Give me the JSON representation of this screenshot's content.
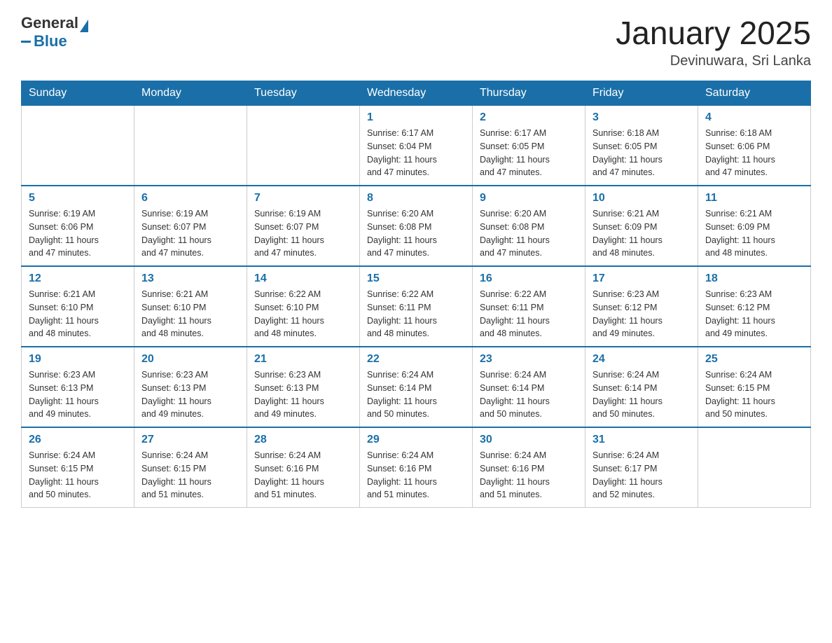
{
  "header": {
    "logo_general": "General",
    "logo_blue": "Blue",
    "title": "January 2025",
    "location": "Devinuwara, Sri Lanka"
  },
  "weekdays": [
    "Sunday",
    "Monday",
    "Tuesday",
    "Wednesday",
    "Thursday",
    "Friday",
    "Saturday"
  ],
  "weeks": [
    [
      {
        "day": "",
        "info": ""
      },
      {
        "day": "",
        "info": ""
      },
      {
        "day": "",
        "info": ""
      },
      {
        "day": "1",
        "info": "Sunrise: 6:17 AM\nSunset: 6:04 PM\nDaylight: 11 hours\nand 47 minutes."
      },
      {
        "day": "2",
        "info": "Sunrise: 6:17 AM\nSunset: 6:05 PM\nDaylight: 11 hours\nand 47 minutes."
      },
      {
        "day": "3",
        "info": "Sunrise: 6:18 AM\nSunset: 6:05 PM\nDaylight: 11 hours\nand 47 minutes."
      },
      {
        "day": "4",
        "info": "Sunrise: 6:18 AM\nSunset: 6:06 PM\nDaylight: 11 hours\nand 47 minutes."
      }
    ],
    [
      {
        "day": "5",
        "info": "Sunrise: 6:19 AM\nSunset: 6:06 PM\nDaylight: 11 hours\nand 47 minutes."
      },
      {
        "day": "6",
        "info": "Sunrise: 6:19 AM\nSunset: 6:07 PM\nDaylight: 11 hours\nand 47 minutes."
      },
      {
        "day": "7",
        "info": "Sunrise: 6:19 AM\nSunset: 6:07 PM\nDaylight: 11 hours\nand 47 minutes."
      },
      {
        "day": "8",
        "info": "Sunrise: 6:20 AM\nSunset: 6:08 PM\nDaylight: 11 hours\nand 47 minutes."
      },
      {
        "day": "9",
        "info": "Sunrise: 6:20 AM\nSunset: 6:08 PM\nDaylight: 11 hours\nand 47 minutes."
      },
      {
        "day": "10",
        "info": "Sunrise: 6:21 AM\nSunset: 6:09 PM\nDaylight: 11 hours\nand 48 minutes."
      },
      {
        "day": "11",
        "info": "Sunrise: 6:21 AM\nSunset: 6:09 PM\nDaylight: 11 hours\nand 48 minutes."
      }
    ],
    [
      {
        "day": "12",
        "info": "Sunrise: 6:21 AM\nSunset: 6:10 PM\nDaylight: 11 hours\nand 48 minutes."
      },
      {
        "day": "13",
        "info": "Sunrise: 6:21 AM\nSunset: 6:10 PM\nDaylight: 11 hours\nand 48 minutes."
      },
      {
        "day": "14",
        "info": "Sunrise: 6:22 AM\nSunset: 6:10 PM\nDaylight: 11 hours\nand 48 minutes."
      },
      {
        "day": "15",
        "info": "Sunrise: 6:22 AM\nSunset: 6:11 PM\nDaylight: 11 hours\nand 48 minutes."
      },
      {
        "day": "16",
        "info": "Sunrise: 6:22 AM\nSunset: 6:11 PM\nDaylight: 11 hours\nand 48 minutes."
      },
      {
        "day": "17",
        "info": "Sunrise: 6:23 AM\nSunset: 6:12 PM\nDaylight: 11 hours\nand 49 minutes."
      },
      {
        "day": "18",
        "info": "Sunrise: 6:23 AM\nSunset: 6:12 PM\nDaylight: 11 hours\nand 49 minutes."
      }
    ],
    [
      {
        "day": "19",
        "info": "Sunrise: 6:23 AM\nSunset: 6:13 PM\nDaylight: 11 hours\nand 49 minutes."
      },
      {
        "day": "20",
        "info": "Sunrise: 6:23 AM\nSunset: 6:13 PM\nDaylight: 11 hours\nand 49 minutes."
      },
      {
        "day": "21",
        "info": "Sunrise: 6:23 AM\nSunset: 6:13 PM\nDaylight: 11 hours\nand 49 minutes."
      },
      {
        "day": "22",
        "info": "Sunrise: 6:24 AM\nSunset: 6:14 PM\nDaylight: 11 hours\nand 50 minutes."
      },
      {
        "day": "23",
        "info": "Sunrise: 6:24 AM\nSunset: 6:14 PM\nDaylight: 11 hours\nand 50 minutes."
      },
      {
        "day": "24",
        "info": "Sunrise: 6:24 AM\nSunset: 6:14 PM\nDaylight: 11 hours\nand 50 minutes."
      },
      {
        "day": "25",
        "info": "Sunrise: 6:24 AM\nSunset: 6:15 PM\nDaylight: 11 hours\nand 50 minutes."
      }
    ],
    [
      {
        "day": "26",
        "info": "Sunrise: 6:24 AM\nSunset: 6:15 PM\nDaylight: 11 hours\nand 50 minutes."
      },
      {
        "day": "27",
        "info": "Sunrise: 6:24 AM\nSunset: 6:15 PM\nDaylight: 11 hours\nand 51 minutes."
      },
      {
        "day": "28",
        "info": "Sunrise: 6:24 AM\nSunset: 6:16 PM\nDaylight: 11 hours\nand 51 minutes."
      },
      {
        "day": "29",
        "info": "Sunrise: 6:24 AM\nSunset: 6:16 PM\nDaylight: 11 hours\nand 51 minutes."
      },
      {
        "day": "30",
        "info": "Sunrise: 6:24 AM\nSunset: 6:16 PM\nDaylight: 11 hours\nand 51 minutes."
      },
      {
        "day": "31",
        "info": "Sunrise: 6:24 AM\nSunset: 6:17 PM\nDaylight: 11 hours\nand 52 minutes."
      },
      {
        "day": "",
        "info": ""
      }
    ]
  ]
}
